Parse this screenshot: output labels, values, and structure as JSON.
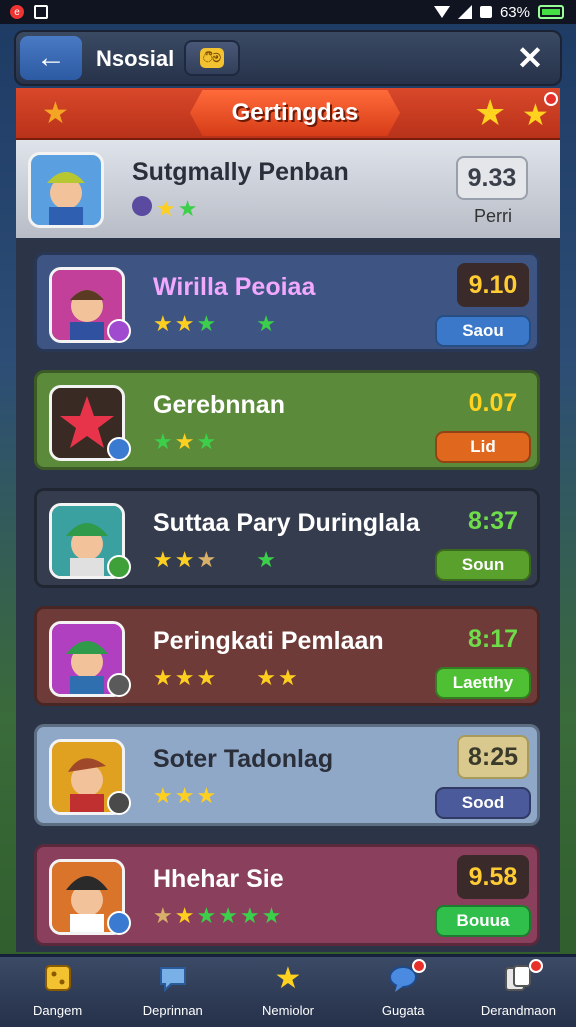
{
  "status_bar": {
    "battery": "63%"
  },
  "header": {
    "title": "Nsosial",
    "coin_label": "ීම",
    "close_symbol": "✕",
    "back_symbol": "←"
  },
  "banner": {
    "title": "Gertingdas"
  },
  "entries": [
    {
      "name": "Sutgmally Penban",
      "score": "9.33",
      "caption": "Perri",
      "button": "",
      "colors": {
        "name": "#2b2f3a",
        "row": "#c7ccd4",
        "score_bg": "#e4e6ea",
        "score_text": "#3a3f4a",
        "button": ""
      }
    },
    {
      "name": "Wirilla Peoiaa",
      "score": "9.10",
      "caption": "",
      "button": "Saou",
      "colors": {
        "name": "#f2a8ff",
        "row": "#3e5583",
        "score_bg": "#3a2a2a",
        "score_text": "#ffcc33",
        "button": "#3b78c9"
      }
    },
    {
      "name": "Gerebnnan",
      "score": "0.07",
      "caption": "",
      "button": "Lid",
      "colors": {
        "name": "#ffffff",
        "row": "#5b8a3a",
        "score_bg": "#5b8a3a",
        "score_text": "#ffd21f",
        "button": "#e0671e"
      }
    },
    {
      "name": "Suttaa Pary Duringlala",
      "score": "8:37",
      "caption": "",
      "button": "Soun",
      "colors": {
        "name": "#ffffff",
        "row": "#343c4e",
        "score_bg": "#343c4e",
        "score_text": "#6fdc4a",
        "button": "#5aa02c"
      }
    },
    {
      "name": "Peringkati Pemlaan",
      "score": "8:17",
      "caption": "",
      "button": "Laetthy",
      "colors": {
        "name": "#ffffff",
        "row": "#6e3b38",
        "score_bg": "#6e3b38",
        "score_text": "#6fdc4a",
        "button": "#4fbf34"
      }
    },
    {
      "name": "Soter Tadonlag",
      "score": "8:25",
      "caption": "",
      "button": "Sood",
      "colors": {
        "name": "#2b2f3a",
        "row": "#8fa8c8",
        "score_bg": "#d9c98f",
        "score_text": "#3a3a2a",
        "button": "#4a5a9a"
      }
    },
    {
      "name": "Hhehar Sie",
      "score": "9.58",
      "caption": "",
      "button": "Bouua",
      "colors": {
        "name": "#ffffff",
        "row": "#8a3f5c",
        "score_bg": "#3a2a2a",
        "score_text": "#ffcc33",
        "button": "#2fbf4a"
      }
    }
  ],
  "bottom_nav": [
    {
      "label": "Dangem",
      "icon": "dice-icon",
      "badge": false
    },
    {
      "label": "Deprinnan",
      "icon": "chat-icon",
      "badge": false
    },
    {
      "label": "Nemiolor",
      "icon": "star-icon",
      "badge": false
    },
    {
      "label": "Gugata",
      "icon": "chat-bubble-icon",
      "badge": true
    },
    {
      "label": "Derandmaon",
      "icon": "cards-icon",
      "badge": true
    }
  ]
}
